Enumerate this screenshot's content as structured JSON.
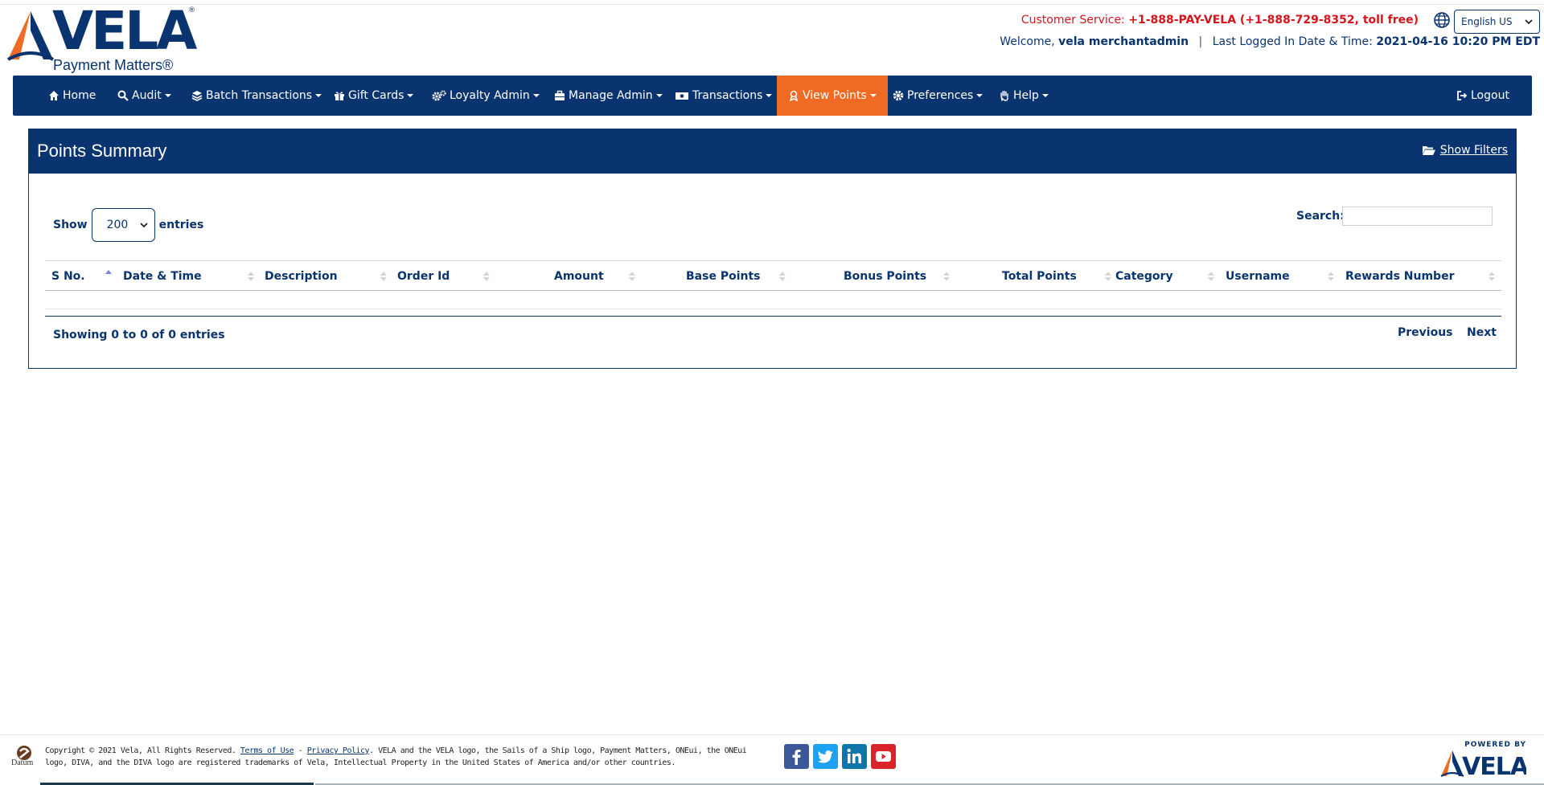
{
  "brand": {
    "name": "VELA",
    "registered": "®",
    "tagline": "Payment Matters®"
  },
  "header": {
    "customer_service_label": "Customer Service:",
    "customer_service_number": "+1-888-PAY-VELA (+1-888-729-8352, toll free)",
    "language": "English US",
    "welcome_label": "Welcome,",
    "username": "vela merchantadmin",
    "separator": "|",
    "last_login_label": "Last Logged In Date & Time:",
    "last_login_value": "2021-04-16 10:20 PM EDT"
  },
  "nav": {
    "items": [
      {
        "label": "Home",
        "icon": "home-icon"
      },
      {
        "label": "Audit",
        "icon": "search-icon"
      },
      {
        "label": "Batch Transactions",
        "icon": "layers-icon"
      },
      {
        "label": "Gift Cards",
        "icon": "gift-icon"
      },
      {
        "label": "Loyalty Admin",
        "icon": "cogs-icon"
      },
      {
        "label": "Manage Admin",
        "icon": "toolbox-icon"
      },
      {
        "label": "Transactions",
        "icon": "money-icon"
      },
      {
        "label": "View Points",
        "icon": "award-icon"
      },
      {
        "label": "Preferences",
        "icon": "gear-icon"
      },
      {
        "label": "Help",
        "icon": "hand-icon"
      }
    ],
    "logout": "Logout"
  },
  "panel": {
    "title": "Points Summary",
    "show_filters": "Show Filters"
  },
  "table": {
    "show_label": "Show",
    "entries_label": "entries",
    "page_size": "200",
    "search_label": "Search:",
    "search_value": "",
    "columns": [
      "S No.",
      "Date & Time",
      "Description",
      "Order Id",
      "Amount",
      "Base Points",
      "Bonus Points",
      "Total Points",
      "Category",
      "Username",
      "Rewards Number"
    ],
    "info": "Showing 0 to 0 of 0 entries",
    "previous": "Previous",
    "next": "Next"
  },
  "footer": {
    "datum_label": "Datum",
    "copyright_prefix": "Copyright © 2021 Vela, All Rights Reserved.",
    "terms": "Terms of Use",
    "dash": "-",
    "privacy": "Privacy Policy",
    "copyright_suffix": ". VELA and the VELA logo, the Sails of a Ship logo, Payment Matters, ONEui, the ONEui logo, DIVA, and the DIVA logo are registered trademarks of Vela, Intellectual Property in the United States of America and/or other countries.",
    "powered_by": "POWERED BY",
    "social": [
      "facebook-icon",
      "twitter-icon",
      "linkedin-icon",
      "youtube-icon"
    ],
    "social_colors": [
      "#3b5998",
      "#1da1f2",
      "#0e76a8",
      "#d9252a"
    ]
  },
  "colors": {
    "primary": "#0a3470",
    "accent": "#ef6a22",
    "alert": "#d6141c"
  }
}
